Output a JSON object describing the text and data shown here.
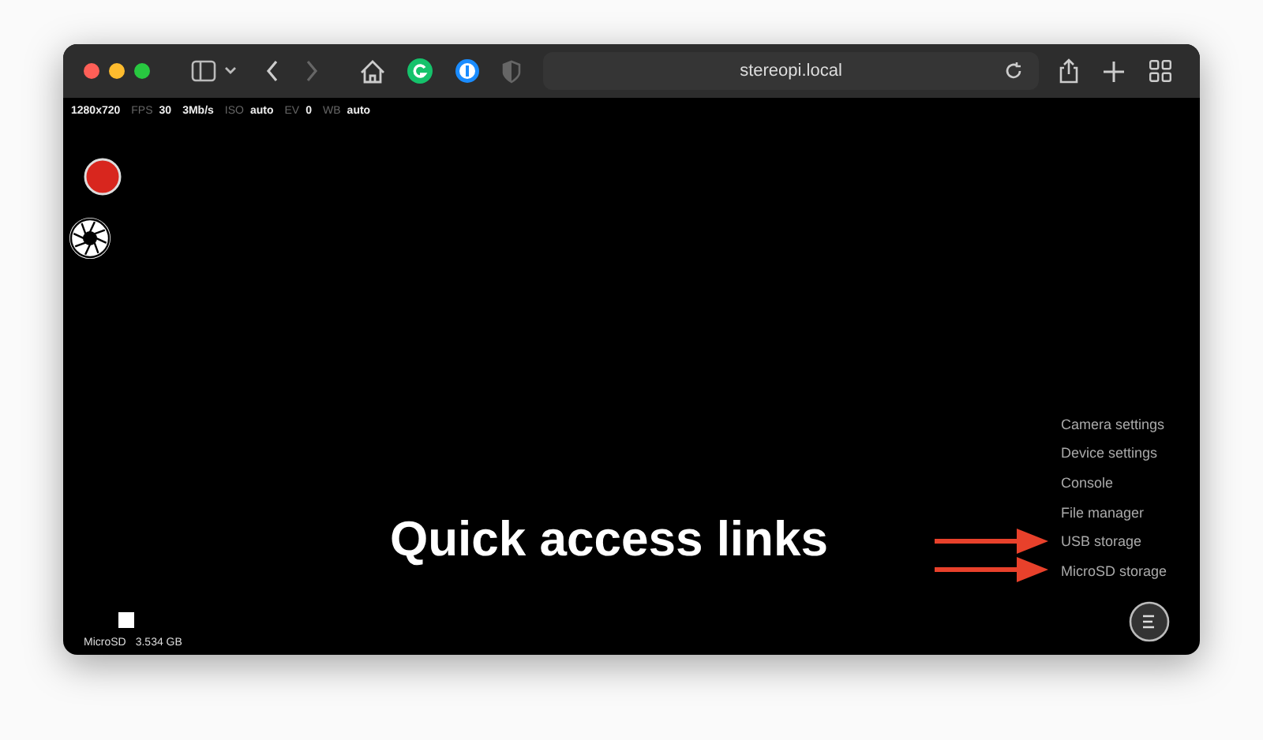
{
  "browser": {
    "address": "stereopi.local"
  },
  "status_bar": [
    {
      "value": "1280x720"
    },
    {
      "label": "FPS",
      "value": "30"
    },
    {
      "value": "3Mb/s"
    },
    {
      "label": "ISO",
      "value": "auto"
    },
    {
      "label": "EV",
      "value": "0"
    },
    {
      "label": "WB",
      "value": "auto"
    }
  ],
  "storage": {
    "label": "MicroSD",
    "value": "3.534 GB"
  },
  "menu": [
    {
      "label": "Camera settings",
      "arrow": false
    },
    {
      "label": "Device settings",
      "arrow": false
    },
    {
      "label": "Console",
      "arrow": false
    },
    {
      "label": "File manager",
      "arrow": false
    },
    {
      "label": "USB storage",
      "arrow": true
    },
    {
      "label": "MicroSD storage",
      "arrow": true
    }
  ],
  "annotation": "Quick access links"
}
